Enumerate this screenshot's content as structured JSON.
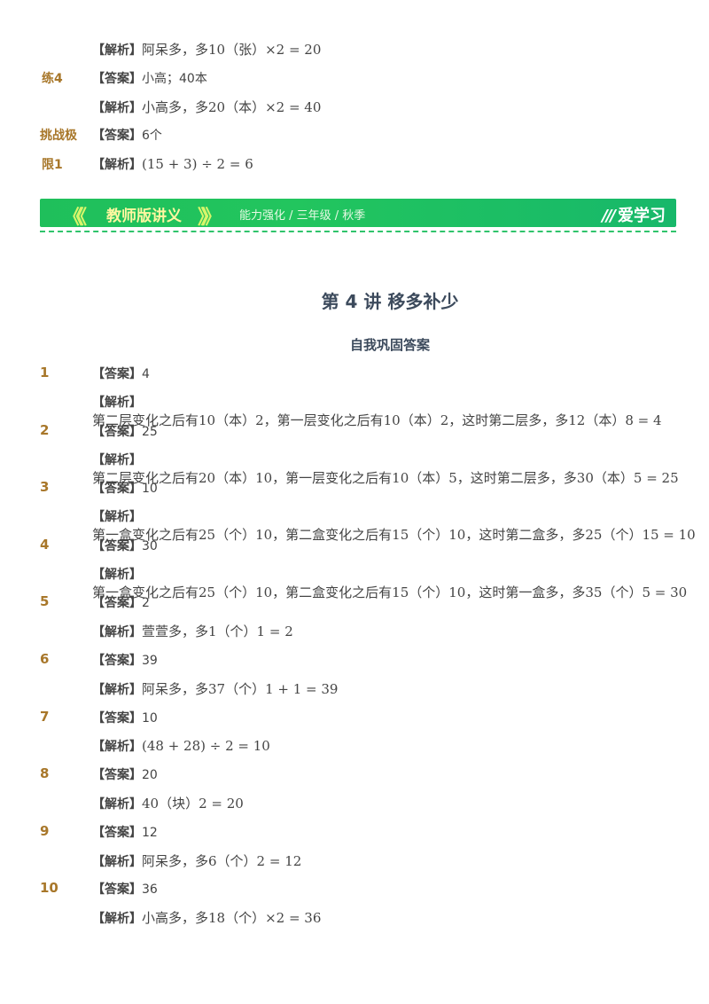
{
  "top": {
    "r1": {
      "tag": "【解析】",
      "text": "阿呆多，多10（张）×2 = 20"
    },
    "r2": {
      "left": "练4",
      "tag": "【答案】",
      "text": "小高；40本"
    },
    "r3": {
      "tag": "【解析】",
      "text": "小高多，多20（本）×2 = 40"
    },
    "r4": {
      "left": "挑战极",
      "tag": "【答案】",
      "text": "6个"
    },
    "r5": {
      "left": "限1",
      "tag": "【解析】",
      "text": "(15 + 3) ÷ 2 = 6"
    }
  },
  "banner": {
    "chevrons_left": "《《",
    "title": "教师版讲义",
    "chevrons_right": "》》",
    "subtitle": "能力强化 / 三年级 / 秋季",
    "logo_mark": "///",
    "logo": "爱学习",
    "colors": {
      "bg": "#22c55e",
      "title": "#fff7a0",
      "chevron": "#d8f56b"
    }
  },
  "lecture_title": "第 4 讲  移多补少",
  "section_title": "自我巩固答案",
  "answer_tag": "【答案】",
  "analysis_tag": "【解析】",
  "items": [
    {
      "num": "1",
      "answer": "4",
      "analysis": "第二层变化之后有10（本）2，第一层变化之后有10（本）2，这时第二层多，多12（本）8 = 4"
    },
    {
      "num": "2",
      "answer": "25",
      "analysis": "第二层变化之后有20（本）10，第一层变化之后有10（本）5，这时第二层多，多30（本）5 = 25"
    },
    {
      "num": "3",
      "answer": "10",
      "analysis": "第一盒变化之后有25（个）10，第二盒变化之后有15（个）10，这时第二盒多，多25（个）15 = 10"
    },
    {
      "num": "4",
      "answer": "30",
      "analysis": "第一盒变化之后有25（个）10，第二盒变化之后有15（个）10，这时第一盒多，多35（个）5 = 30"
    },
    {
      "num": "5",
      "answer": "2",
      "analysis": "萱萱多，多1（个）1 = 2"
    },
    {
      "num": "6",
      "answer": "39",
      "analysis": "阿呆多，多37（个）1 + 1 = 39"
    },
    {
      "num": "7",
      "answer": "10",
      "analysis": "(48 + 28) ÷ 2 = 10"
    },
    {
      "num": "8",
      "answer": "20",
      "analysis": "40（块）2 = 20"
    },
    {
      "num": "9",
      "answer": "12",
      "analysis": "阿呆多，多6（个）2 = 12"
    },
    {
      "num": "10",
      "answer": "36",
      "analysis": "小高多，多18（个）×2 = 36"
    }
  ]
}
